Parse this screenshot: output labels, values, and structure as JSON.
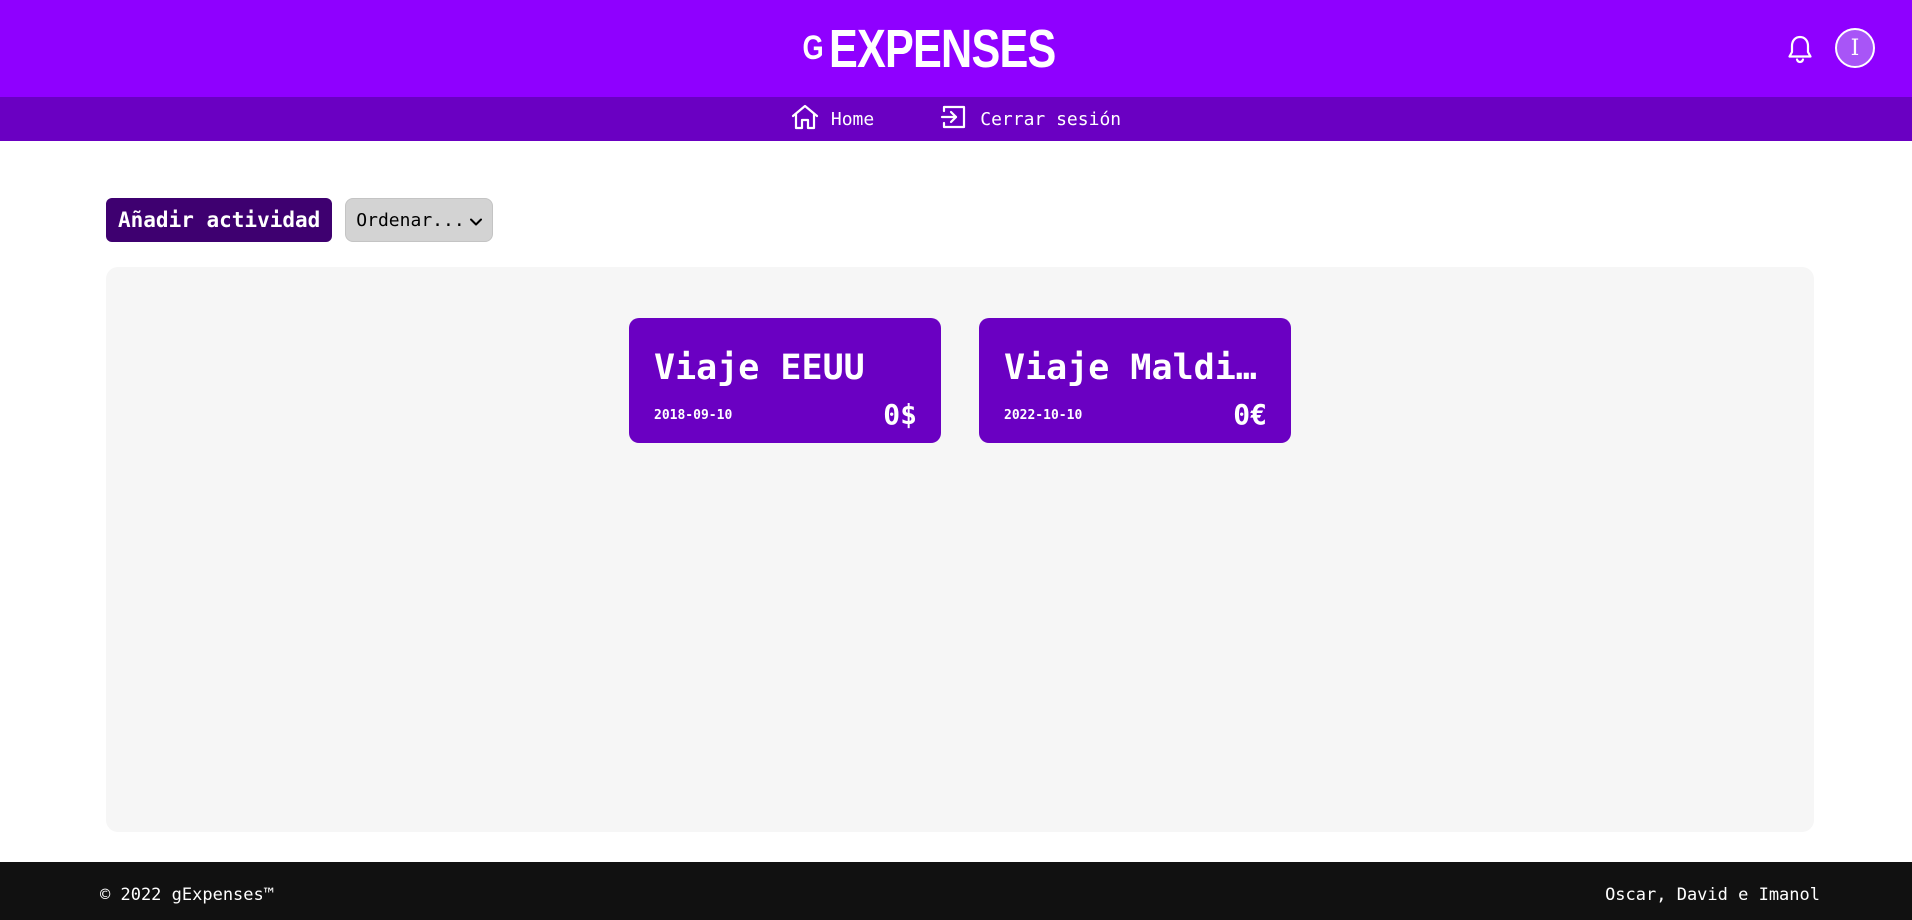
{
  "header": {
    "brand_small": "G",
    "brand_big": "EXPENSES",
    "avatar_initial": "I",
    "bell_icon": "bell-icon"
  },
  "nav": {
    "home_label": "Home",
    "home_icon": "home-icon",
    "logout_label": "Cerrar sesión",
    "logout_icon": "logout-icon"
  },
  "toolbar": {
    "add_label": "Añadir actividad",
    "sort_selected": "Ordenar..."
  },
  "activities": [
    {
      "title": "Viaje EEUU",
      "date": "2018-09-10",
      "amount": "0$"
    },
    {
      "title": "Viaje Maldiv…",
      "date": "2022-10-10",
      "amount": "0€"
    }
  ],
  "footer": {
    "copyright": "© 2022 gExpenses™",
    "authors": "Oscar, David e Imanol"
  },
  "colors": {
    "primary": "#8f00ff",
    "nav": "#6a00c2",
    "card": "#6a00c2",
    "button": "#3e0070",
    "footer": "#111111"
  }
}
